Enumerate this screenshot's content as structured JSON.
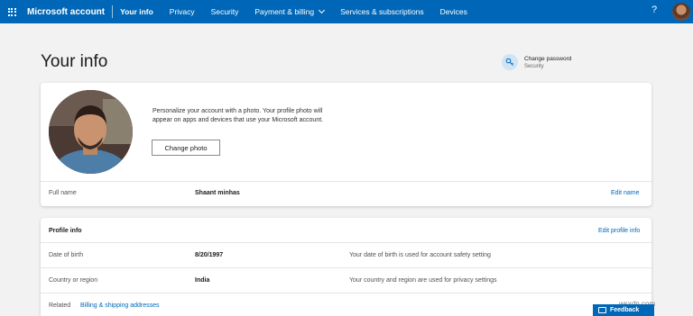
{
  "colors": {
    "accent": "#0067b8",
    "background": "#f2f2f2"
  },
  "nav": {
    "brand": "Microsoft account",
    "items": [
      {
        "label": "Your info"
      },
      {
        "label": "Privacy"
      },
      {
        "label": "Security"
      },
      {
        "label": "Payment & billing"
      },
      {
        "label": "Services & subscriptions"
      },
      {
        "label": "Devices"
      }
    ],
    "help": "?"
  },
  "page": {
    "title": "Your info"
  },
  "change_password": {
    "title": "Change password",
    "subtitle": "Security",
    "icon": "key-icon"
  },
  "photo_card": {
    "description": "Personalize your account with a photo. Your profile photo will appear on apps and devices that use your Microsoft account.",
    "button": "Change photo",
    "full_name_label": "Full name",
    "full_name_value": "Shaant minhas",
    "edit_name": "Edit name"
  },
  "profile_info": {
    "heading": "Profile info",
    "edit": "Edit profile info",
    "rows": [
      {
        "label": "Date of birth",
        "value": "8/20/1997",
        "note": "Your date of birth is used for account safety setting"
      },
      {
        "label": "Country or region",
        "value": "India",
        "note": "Your country and region are used for privacy settings"
      }
    ],
    "related_label": "Related",
    "related_link": "Billing & shipping addresses"
  },
  "feedback": {
    "label": "Feedback"
  },
  "watermark": "wsxdn.com"
}
